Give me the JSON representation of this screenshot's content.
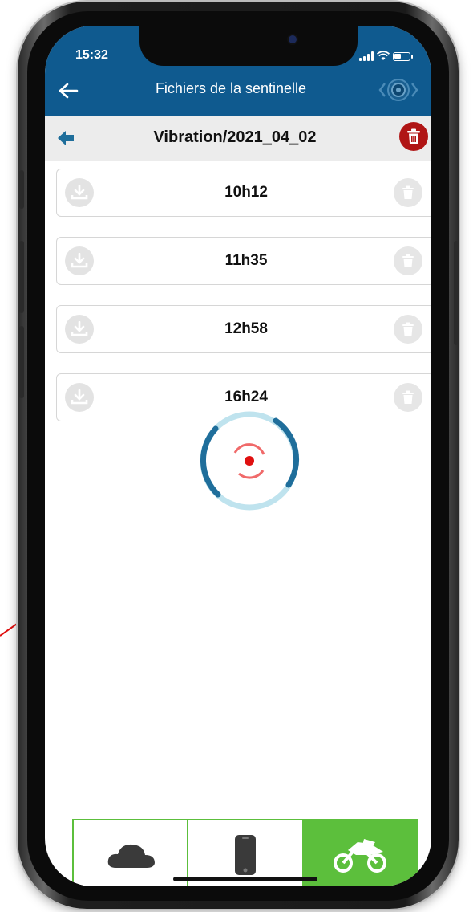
{
  "status_bar": {
    "time": "15:32"
  },
  "app_bar": {
    "title": "Fichiers de la sentinelle",
    "back_icon": "arrow-left-icon",
    "sensor_icon": "sentinel-sensor-icon"
  },
  "sub_header": {
    "title": "Vibration/2021_04_02",
    "back_icon": "arrow-left-icon",
    "delete_icon": "trash-icon"
  },
  "files": [
    {
      "label": "10h12"
    },
    {
      "label": "11h35"
    },
    {
      "label": "12h58"
    },
    {
      "label": "16h24"
    }
  ],
  "tabs": [
    {
      "icon": "cloud-icon",
      "active": false
    },
    {
      "icon": "phone-icon",
      "active": false
    },
    {
      "icon": "motorcycle-icon",
      "active": true
    }
  ],
  "colors": {
    "primary": "#0f5a8f",
    "accent_green": "#5cbf3c",
    "danger": "#b01515",
    "spinner_dark": "#1f6e9b",
    "spinner_light": "#bfe3ee",
    "annotation": "#e01010"
  }
}
